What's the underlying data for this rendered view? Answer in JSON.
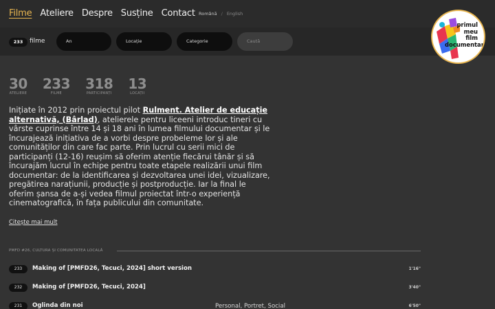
{
  "nav": {
    "items": [
      {
        "label": "Filme",
        "active": true
      },
      {
        "label": "Ateliere",
        "active": false
      },
      {
        "label": "Despre",
        "active": false
      },
      {
        "label": "Susține",
        "active": false
      },
      {
        "label": "Contact",
        "active": false
      }
    ],
    "lang": {
      "ro": "Română",
      "sep": "/",
      "en": "English"
    }
  },
  "filters": {
    "count": "233",
    "count_label": "filme",
    "an": "An",
    "locatie": "Locație",
    "categorie": "Categorie",
    "search_placeholder": "Caută"
  },
  "logo": {
    "lines": [
      "primul",
      "meu",
      "film",
      "documentar"
    ]
  },
  "stats": [
    {
      "value": "30",
      "label": "ATELIERE"
    },
    {
      "value": "233",
      "label": "FILME"
    },
    {
      "value": "318",
      "label": "PARTICIPANȚI"
    },
    {
      "value": "13",
      "label": "LOCAȚII"
    }
  ],
  "intro": {
    "before": "Inițiate în 2012 prin proiectul pilot ",
    "link": "Rulment. Atelier de educație alternativă, (Bârlad)",
    "after": ", atelierele pentru liceeni introduc tineri cu vârste cuprinse între 14 și 18 ani în lumea filmului documentar și le încurajează inițiativa de a vorbi despre probeleme lor și ale comunităților din care fac parte. Prin lucrul cu serii mici de participanți (12-16) reușim să oferim atenție fiecărui tânăr și să încurajăm lucrul în echipe pentru toate etapele realizării unui film documentar: de la identificarea și dezvoltarea unei idei, vizualizare, pregătirea narațiunii, producție și postproducție. Iar la final le oferim șansa de a-și vedea filmul proiectat într-o experiență cinematografică, în fața publicului din comunitate.",
    "read_more": "Citește mai mult"
  },
  "section": {
    "title": "PMFD #26, CULTURA ȘI COMUNITATEA LOCALĂ",
    "films": [
      {
        "num": "233",
        "title": "Making of [PMFD26, Tecuci, 2024] short version",
        "tags": "",
        "duration": "1'16\""
      },
      {
        "num": "232",
        "title": "Making of [PMFD26, Tecuci, 2024]",
        "tags": "",
        "duration": "3'40\""
      },
      {
        "num": "231",
        "title": "Oglinda din noi",
        "tags": "Personal, Portret, Social",
        "duration": "6'50\""
      }
    ]
  },
  "colors": {
    "accent": "#e9b650",
    "background": "#333333",
    "topbar": "#2b2b2b",
    "pill": "#111111"
  }
}
